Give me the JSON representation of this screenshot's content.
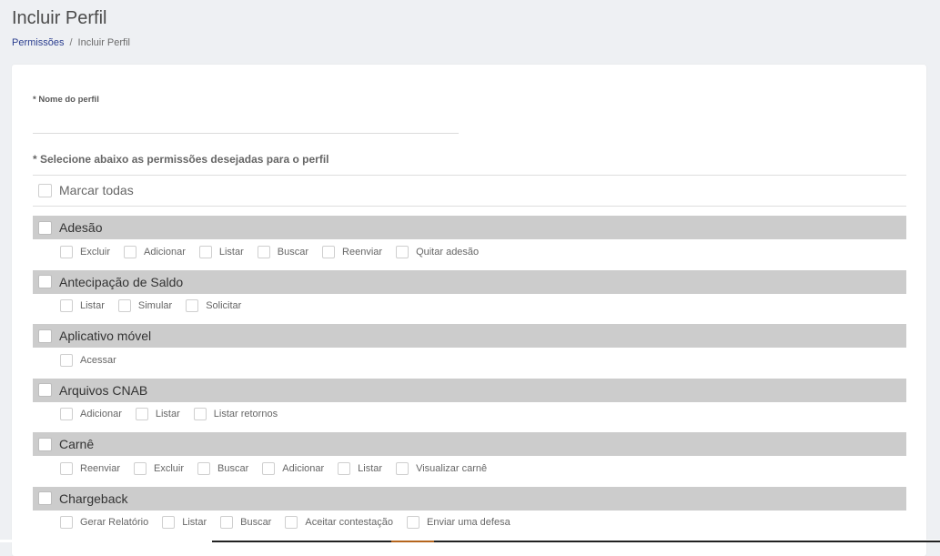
{
  "header": {
    "title": "Incluir Perfil",
    "breadcrumb": {
      "link": "Permissões",
      "separator": "/",
      "current": "Incluir Perfil"
    }
  },
  "form": {
    "name_label": "* Nome do perfil",
    "name_value": "",
    "permissions_title": "* Selecione abaixo as permissões desejadas para o perfil",
    "select_all_label": "Marcar todas"
  },
  "groups": [
    {
      "name": "Adesão",
      "permissions": [
        "Excluir",
        "Adicionar",
        "Listar",
        "Buscar",
        "Reenviar",
        "Quitar adesão"
      ]
    },
    {
      "name": "Antecipação de Saldo",
      "permissions": [
        "Listar",
        "Simular",
        "Solicitar"
      ]
    },
    {
      "name": "Aplicativo móvel",
      "permissions": [
        "Acessar"
      ]
    },
    {
      "name": "Arquivos CNAB",
      "permissions": [
        "Adicionar",
        "Listar",
        "Listar retornos"
      ]
    },
    {
      "name": "Carnê",
      "permissions": [
        "Reenviar",
        "Excluir",
        "Buscar",
        "Adicionar",
        "Listar",
        "Visualizar carnê"
      ]
    },
    {
      "name": "Chargeback",
      "permissions": [
        "Gerar Relatório",
        "Listar",
        "Buscar",
        "Aceitar contestação",
        "Enviar uma defesa"
      ]
    }
  ],
  "colors": {
    "background": "#eef0f3",
    "group_header": "#cccccc",
    "link": "#2b3e8f"
  }
}
